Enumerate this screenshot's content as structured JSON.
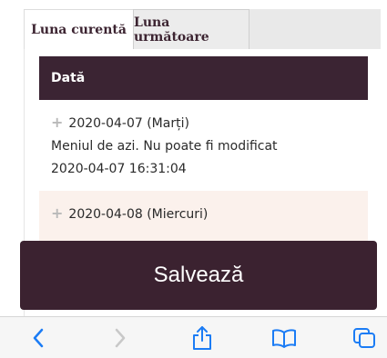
{
  "tabs": {
    "current": "Luna curentă",
    "next": "Luna următoare"
  },
  "table": {
    "header": "Dată",
    "rows": [
      {
        "date": "2020-04-07 (Marți)",
        "note": "Meniul de azi. Nu poate fi modificat",
        "timestamp": "2020-04-07 16:31:04"
      },
      {
        "date": "2020-04-08 (Miercuri)"
      }
    ]
  },
  "save_label": "Salvează",
  "toolbar": {
    "icons": [
      "chevron-left-icon",
      "chevron-right-icon",
      "share-icon",
      "bookmarks-icon",
      "tabs-icon"
    ],
    "accent": "#1b7cf5"
  },
  "colors": {
    "brand_dark": "#3b2433",
    "row_highlight": "#fbf1ec"
  }
}
